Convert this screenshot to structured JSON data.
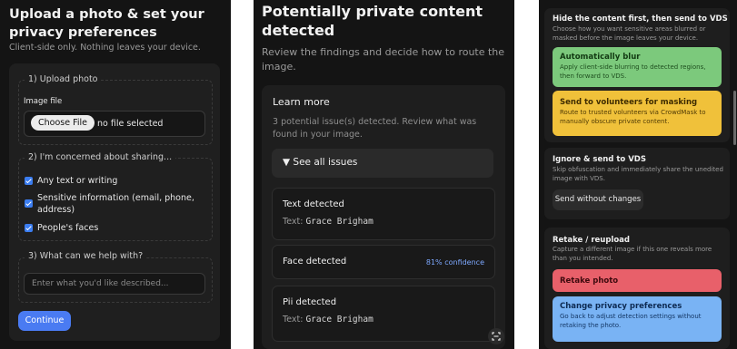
{
  "panel1": {
    "title": "Upload a photo & set your privacy preferences",
    "subtitle": "Client-side only. Nothing leaves your device.",
    "upload_legend": "1) Upload photo",
    "image_file_label": "Image file",
    "choose_file": "Choose File",
    "no_file": "no file selected",
    "concern_legend": "2) I'm concerned about sharing...",
    "concerns": [
      "Any text or writing",
      "Sensitive information (email, phone, address)",
      "People's faces"
    ],
    "help_legend": "3) What can we help with?",
    "help_placeholder": "Enter what you'd like described...",
    "continue": "Continue"
  },
  "panel2": {
    "title": "Potentially private content detected",
    "subtitle": "Review the findings and decide how to route the image.",
    "learn_more": "Learn more",
    "summary": "3 potential issue(s) detected. Review what was found in your image.",
    "see_all": "▼ See all issues",
    "issues": [
      {
        "title": "Text detected",
        "prefix": "Text: ",
        "value": "Grace Brigham"
      },
      {
        "title": "Face detected",
        "confidence": "81% confidence"
      },
      {
        "title": "Pii detected",
        "prefix": "Text: ",
        "value": "Grace Brigham"
      }
    ],
    "scan_icon": "scan-icon"
  },
  "panel3": {
    "hide_title": "Hide the content first, then send to VDS",
    "hide_desc": "Choose how you want sensitive areas blurred or masked before the image leaves your device.",
    "auto_blur_title": "Automatically blur",
    "auto_blur_desc": "Apply client-side blurring to detected regions, then forward to VDS.",
    "volunteers_title": "Send to volunteers for masking",
    "volunteers_desc": "Route to trusted volunteers via CrowdMask to manually obscure private content.",
    "ignore_title": "Ignore & send to VDS",
    "ignore_desc": "Skip obfuscation and immediately share the unedited image with VDS.",
    "send_without": "Send without changes",
    "retake_title": "Retake / reupload",
    "retake_desc": "Capture a different image if this one reveals more than you intended.",
    "retake_photo": "Retake photo",
    "change_pref_title": "Change privacy preferences",
    "change_pref_desc": "Go back to adjust detection settings without retaking the photo."
  },
  "colors": {
    "background": "#141414",
    "accent_blue": "#4a7bf2",
    "green": "#7cc97c",
    "yellow": "#f0c13a",
    "red": "#e8606a",
    "light_blue": "#79b3f4"
  }
}
